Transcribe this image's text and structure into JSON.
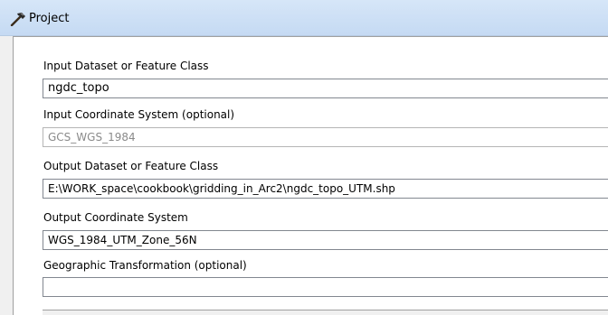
{
  "window": {
    "title": "Project",
    "title_icon": "hammer-icon"
  },
  "form": {
    "input_dataset": {
      "label": "Input Dataset or Feature Class",
      "value": "ngdc_topo"
    },
    "input_coordinate_system": {
      "label": "Input Coordinate System (optional)",
      "value": "GCS_WGS_1984"
    },
    "output_dataset": {
      "label": "Output Dataset or Feature Class",
      "value": "E:\\WORK_space\\cookbook\\gridding_in_Arc2\\ngdc_topo_UTM.shp"
    },
    "output_coordinate_system": {
      "label": "Output Coordinate System",
      "value": "WGS_1984_UTM_Zone_56N"
    },
    "geographic_transformation": {
      "label": "Geographic Transformation (optional)",
      "value": ""
    }
  }
}
